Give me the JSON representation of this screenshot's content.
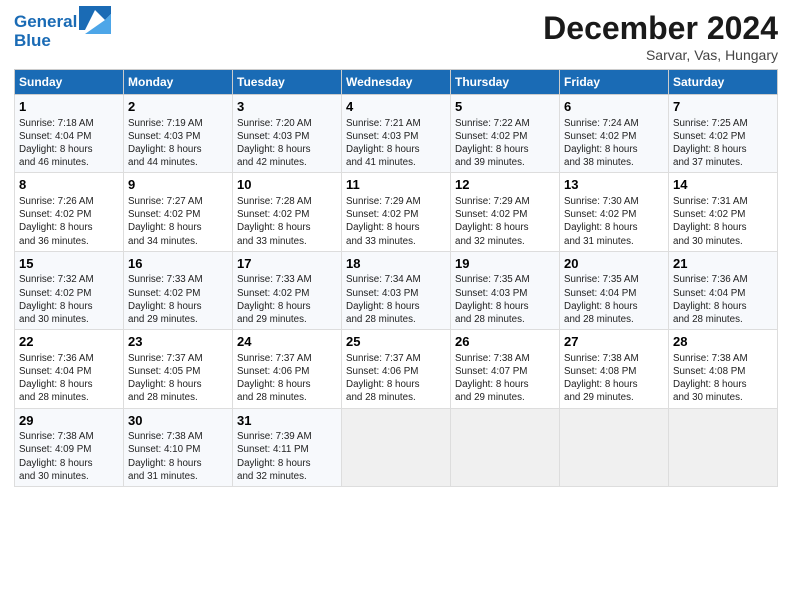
{
  "logo": {
    "line1": "General",
    "line2": "Blue"
  },
  "title": "December 2024",
  "subtitle": "Sarvar, Vas, Hungary",
  "days_of_week": [
    "Sunday",
    "Monday",
    "Tuesday",
    "Wednesday",
    "Thursday",
    "Friday",
    "Saturday"
  ],
  "weeks": [
    [
      {
        "day": "1",
        "info": "Sunrise: 7:18 AM\nSunset: 4:04 PM\nDaylight: 8 hours\nand 46 minutes."
      },
      {
        "day": "2",
        "info": "Sunrise: 7:19 AM\nSunset: 4:03 PM\nDaylight: 8 hours\nand 44 minutes."
      },
      {
        "day": "3",
        "info": "Sunrise: 7:20 AM\nSunset: 4:03 PM\nDaylight: 8 hours\nand 42 minutes."
      },
      {
        "day": "4",
        "info": "Sunrise: 7:21 AM\nSunset: 4:03 PM\nDaylight: 8 hours\nand 41 minutes."
      },
      {
        "day": "5",
        "info": "Sunrise: 7:22 AM\nSunset: 4:02 PM\nDaylight: 8 hours\nand 39 minutes."
      },
      {
        "day": "6",
        "info": "Sunrise: 7:24 AM\nSunset: 4:02 PM\nDaylight: 8 hours\nand 38 minutes."
      },
      {
        "day": "7",
        "info": "Sunrise: 7:25 AM\nSunset: 4:02 PM\nDaylight: 8 hours\nand 37 minutes."
      }
    ],
    [
      {
        "day": "8",
        "info": "Sunrise: 7:26 AM\nSunset: 4:02 PM\nDaylight: 8 hours\nand 36 minutes."
      },
      {
        "day": "9",
        "info": "Sunrise: 7:27 AM\nSunset: 4:02 PM\nDaylight: 8 hours\nand 34 minutes."
      },
      {
        "day": "10",
        "info": "Sunrise: 7:28 AM\nSunset: 4:02 PM\nDaylight: 8 hours\nand 33 minutes."
      },
      {
        "day": "11",
        "info": "Sunrise: 7:29 AM\nSunset: 4:02 PM\nDaylight: 8 hours\nand 33 minutes."
      },
      {
        "day": "12",
        "info": "Sunrise: 7:29 AM\nSunset: 4:02 PM\nDaylight: 8 hours\nand 32 minutes."
      },
      {
        "day": "13",
        "info": "Sunrise: 7:30 AM\nSunset: 4:02 PM\nDaylight: 8 hours\nand 31 minutes."
      },
      {
        "day": "14",
        "info": "Sunrise: 7:31 AM\nSunset: 4:02 PM\nDaylight: 8 hours\nand 30 minutes."
      }
    ],
    [
      {
        "day": "15",
        "info": "Sunrise: 7:32 AM\nSunset: 4:02 PM\nDaylight: 8 hours\nand 30 minutes."
      },
      {
        "day": "16",
        "info": "Sunrise: 7:33 AM\nSunset: 4:02 PM\nDaylight: 8 hours\nand 29 minutes."
      },
      {
        "day": "17",
        "info": "Sunrise: 7:33 AM\nSunset: 4:02 PM\nDaylight: 8 hours\nand 29 minutes."
      },
      {
        "day": "18",
        "info": "Sunrise: 7:34 AM\nSunset: 4:03 PM\nDaylight: 8 hours\nand 28 minutes."
      },
      {
        "day": "19",
        "info": "Sunrise: 7:35 AM\nSunset: 4:03 PM\nDaylight: 8 hours\nand 28 minutes."
      },
      {
        "day": "20",
        "info": "Sunrise: 7:35 AM\nSunset: 4:04 PM\nDaylight: 8 hours\nand 28 minutes."
      },
      {
        "day": "21",
        "info": "Sunrise: 7:36 AM\nSunset: 4:04 PM\nDaylight: 8 hours\nand 28 minutes."
      }
    ],
    [
      {
        "day": "22",
        "info": "Sunrise: 7:36 AM\nSunset: 4:04 PM\nDaylight: 8 hours\nand 28 minutes."
      },
      {
        "day": "23",
        "info": "Sunrise: 7:37 AM\nSunset: 4:05 PM\nDaylight: 8 hours\nand 28 minutes."
      },
      {
        "day": "24",
        "info": "Sunrise: 7:37 AM\nSunset: 4:06 PM\nDaylight: 8 hours\nand 28 minutes."
      },
      {
        "day": "25",
        "info": "Sunrise: 7:37 AM\nSunset: 4:06 PM\nDaylight: 8 hours\nand 28 minutes."
      },
      {
        "day": "26",
        "info": "Sunrise: 7:38 AM\nSunset: 4:07 PM\nDaylight: 8 hours\nand 29 minutes."
      },
      {
        "day": "27",
        "info": "Sunrise: 7:38 AM\nSunset: 4:08 PM\nDaylight: 8 hours\nand 29 minutes."
      },
      {
        "day": "28",
        "info": "Sunrise: 7:38 AM\nSunset: 4:08 PM\nDaylight: 8 hours\nand 30 minutes."
      }
    ],
    [
      {
        "day": "29",
        "info": "Sunrise: 7:38 AM\nSunset: 4:09 PM\nDaylight: 8 hours\nand 30 minutes."
      },
      {
        "day": "30",
        "info": "Sunrise: 7:38 AM\nSunset: 4:10 PM\nDaylight: 8 hours\nand 31 minutes."
      },
      {
        "day": "31",
        "info": "Sunrise: 7:39 AM\nSunset: 4:11 PM\nDaylight: 8 hours\nand 32 minutes."
      },
      null,
      null,
      null,
      null
    ]
  ]
}
